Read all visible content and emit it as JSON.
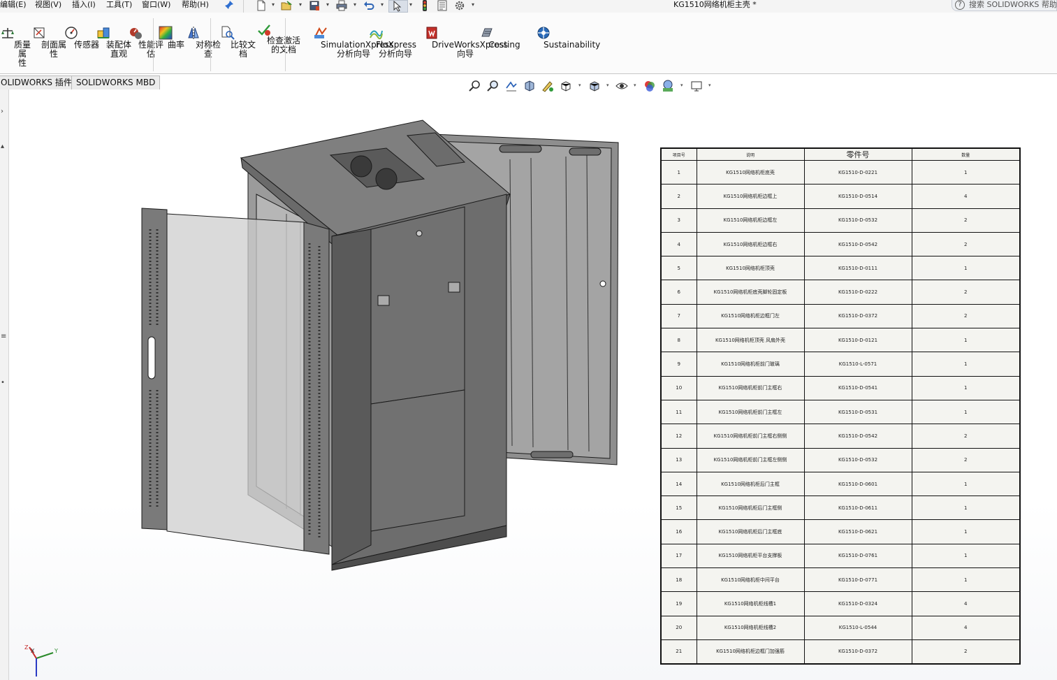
{
  "menu": {
    "items": [
      "编辑(E)",
      "视图(V)",
      "插入(I)",
      "工具(T)",
      "窗口(W)",
      "帮助(H)"
    ]
  },
  "document_title": "KG1510网络机柜主壳 *",
  "search": {
    "placeholder": "搜索 SOLIDWORKS 帮助"
  },
  "ribbon": {
    "tools": [
      {
        "label": "质量属\n性",
        "icon": "mass-properties-icon"
      },
      {
        "label": "剖面属\n性",
        "icon": "section-properties-icon"
      },
      {
        "label": "传感器",
        "icon": "sensor-icon"
      },
      {
        "label": "装配体\n直观",
        "icon": "assemblyxpert-icon"
      },
      {
        "label": "性能评\n估",
        "icon": "performance-evaluation-icon"
      },
      {
        "label": "曲率",
        "icon": "curvature-icon"
      },
      {
        "label": "对称检\n查",
        "icon": "symmetry-check-icon"
      },
      {
        "label": "比较文\n档",
        "icon": "compare-documents-icon"
      },
      {
        "label": "检查激活\n的文档",
        "icon": "check-active-document-icon"
      },
      {
        "label": "SimulationXpress\n分析向导",
        "icon": "simulationxpress-icon"
      },
      {
        "label": "FloXpress\n分析向导",
        "icon": "floxpress-icon"
      },
      {
        "label": "DriveWorksXpress\n向导",
        "icon": "driveworksxpress-icon"
      },
      {
        "label": "Costing",
        "icon": "costing-icon"
      },
      {
        "label": "Sustainability",
        "icon": "sustainability-icon"
      }
    ]
  },
  "tabs": [
    "OLIDWORKS 插件",
    "SOLIDWORKS MBD"
  ],
  "bom": {
    "headers": [
      "项目号",
      "说明",
      "零件号",
      "数量"
    ],
    "rows": [
      [
        "1",
        "KG1510网络机柜底壳",
        "KG1510-D-0221",
        "1"
      ],
      [
        "2",
        "KG1510网络机柜边框上",
        "KG1510-D-0514",
        "4"
      ],
      [
        "3",
        "KG1510网络机柜边框左",
        "KG1510-D-0532",
        "2"
      ],
      [
        "4",
        "KG1510网络机柜边框右",
        "KG1510-D-0542",
        "2"
      ],
      [
        "5",
        "KG1510网络机柜顶壳",
        "KG1510-D-0111",
        "1"
      ],
      [
        "6",
        "KG1510网络机柜底壳脚轮固定板",
        "KG1510-D-0222",
        "2"
      ],
      [
        "7",
        "KG1510网络机柜边框门左",
        "KG1510-D-0372",
        "2"
      ],
      [
        "8",
        "KG1510网络机柜顶壳 风扇外壳",
        "KG1510-D-0121",
        "1"
      ],
      [
        "9",
        "KG1510网络机柜前门玻璃",
        "KG1510-L-0571",
        "1"
      ],
      [
        "10",
        "KG1510网络机柜前门主框右",
        "KG1510-D-0541",
        "1"
      ],
      [
        "11",
        "KG1510网络机柜前门主框左",
        "KG1510-D-0531",
        "1"
      ],
      [
        "12",
        "KG1510网络机柜前门主框右侧侧",
        "KG1510-D-0542",
        "2"
      ],
      [
        "13",
        "KG1510网络机柜前门主框左侧侧",
        "KG1510-D-0532",
        "2"
      ],
      [
        "14",
        "KG1510网络机柜后门主框",
        "KG1510-D-0601",
        "1"
      ],
      [
        "15",
        "KG1510网络机柜后门主框侧",
        "KG1510-D-0611",
        "1"
      ],
      [
        "16",
        "KG1510网络机柜后门主框底",
        "KG1510-D-0621",
        "1"
      ],
      [
        "17",
        "KG1510网络机柜平台支撑板",
        "KG1510-D-0761",
        "1"
      ],
      [
        "18",
        "KG1510网络机柜中间平台",
        "KG1510-D-0771",
        "1"
      ],
      [
        "19",
        "KG1510网络机柜线槽1",
        "KG1510-D-0324",
        "4"
      ],
      [
        "20",
        "KG1510网络机柜线槽2",
        "KG1510-L-0544",
        "4"
      ],
      [
        "21",
        "KG1510网络机柜边框门加强筋",
        "KG1510-D-0372",
        "2"
      ]
    ]
  },
  "triad": {
    "x_label": "X",
    "y_label": "Y",
    "z_label": "Z"
  }
}
